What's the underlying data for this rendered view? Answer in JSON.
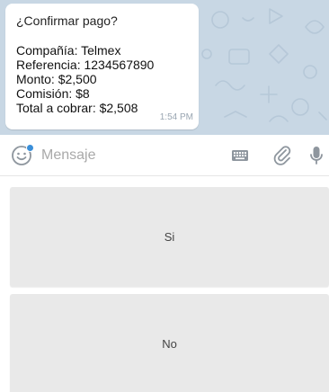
{
  "colors": {
    "chat_background": "#c8d7e4",
    "bubble_background": "#ffffff",
    "reply_button": "#e9e9e9",
    "notification_dot": "#3a8fd9"
  },
  "message": {
    "question": "¿Confirmar pago?",
    "details": [
      "Compañía: Telmex",
      "Referencia: 1234567890",
      "Monto: $2,500",
      "Comisión: $8",
      "Total a cobrar: $2,508"
    ],
    "time": "1:54 PM"
  },
  "input_bar": {
    "placeholder": "Mensaje",
    "icons": [
      "emoji-icon",
      "keyboard-icon",
      "paperclip-icon",
      "microphone-icon"
    ]
  },
  "reply_keyboard": {
    "buttons": [
      "Si",
      "No"
    ]
  }
}
